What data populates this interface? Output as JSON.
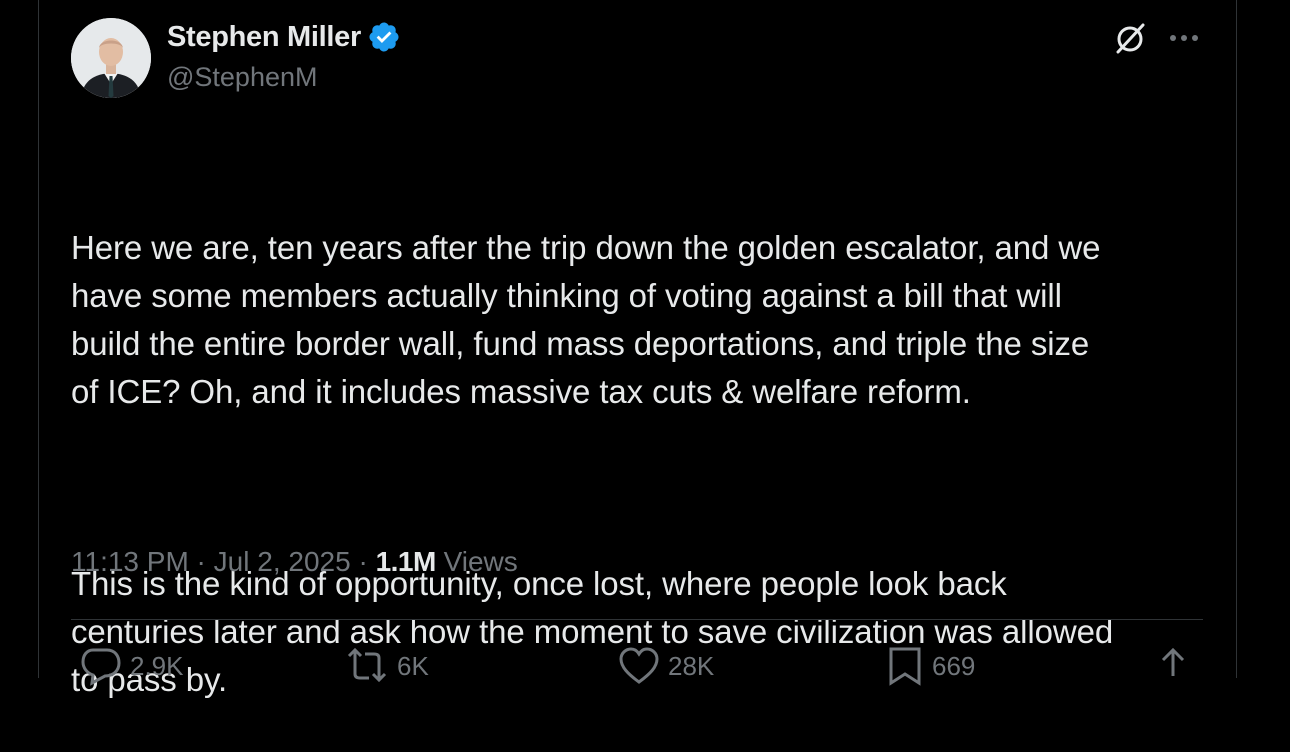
{
  "author": {
    "name": "Stephen Miller",
    "handle": "@StephenM",
    "verified": true
  },
  "tweet": {
    "paragraphs": [
      "Here we are, ten years after the trip down the golden escalator, and we\nhave some members actually thinking of voting against a bill that will\nbuild the entire border wall, fund mass deportations, and triple the size\nof ICE? Oh, and it includes massive tax cuts & welfare reform.",
      "This is the kind of opportunity, once lost, where people look back\ncenturies later and ask how the moment to save civilization was allowed\nto pass by."
    ],
    "time": "11:13 PM",
    "separator": " · ",
    "date": "Jul 2, 2025",
    "views_count": "1.1M",
    "views_label": " Views"
  },
  "actions": {
    "replies": "2.9K",
    "reposts": "6K",
    "likes": "28K",
    "bookmarks": "669"
  },
  "colors": {
    "background": "#000000",
    "text_primary": "#e7e9ea",
    "text_secondary": "#71767b",
    "verified_badge": "#1d9bf0",
    "divider": "#2f3336"
  },
  "icons": [
    "grok-icon",
    "more-icon",
    "verified-badge-icon",
    "reply-icon",
    "repost-icon",
    "like-icon",
    "bookmark-icon",
    "share-icon"
  ]
}
